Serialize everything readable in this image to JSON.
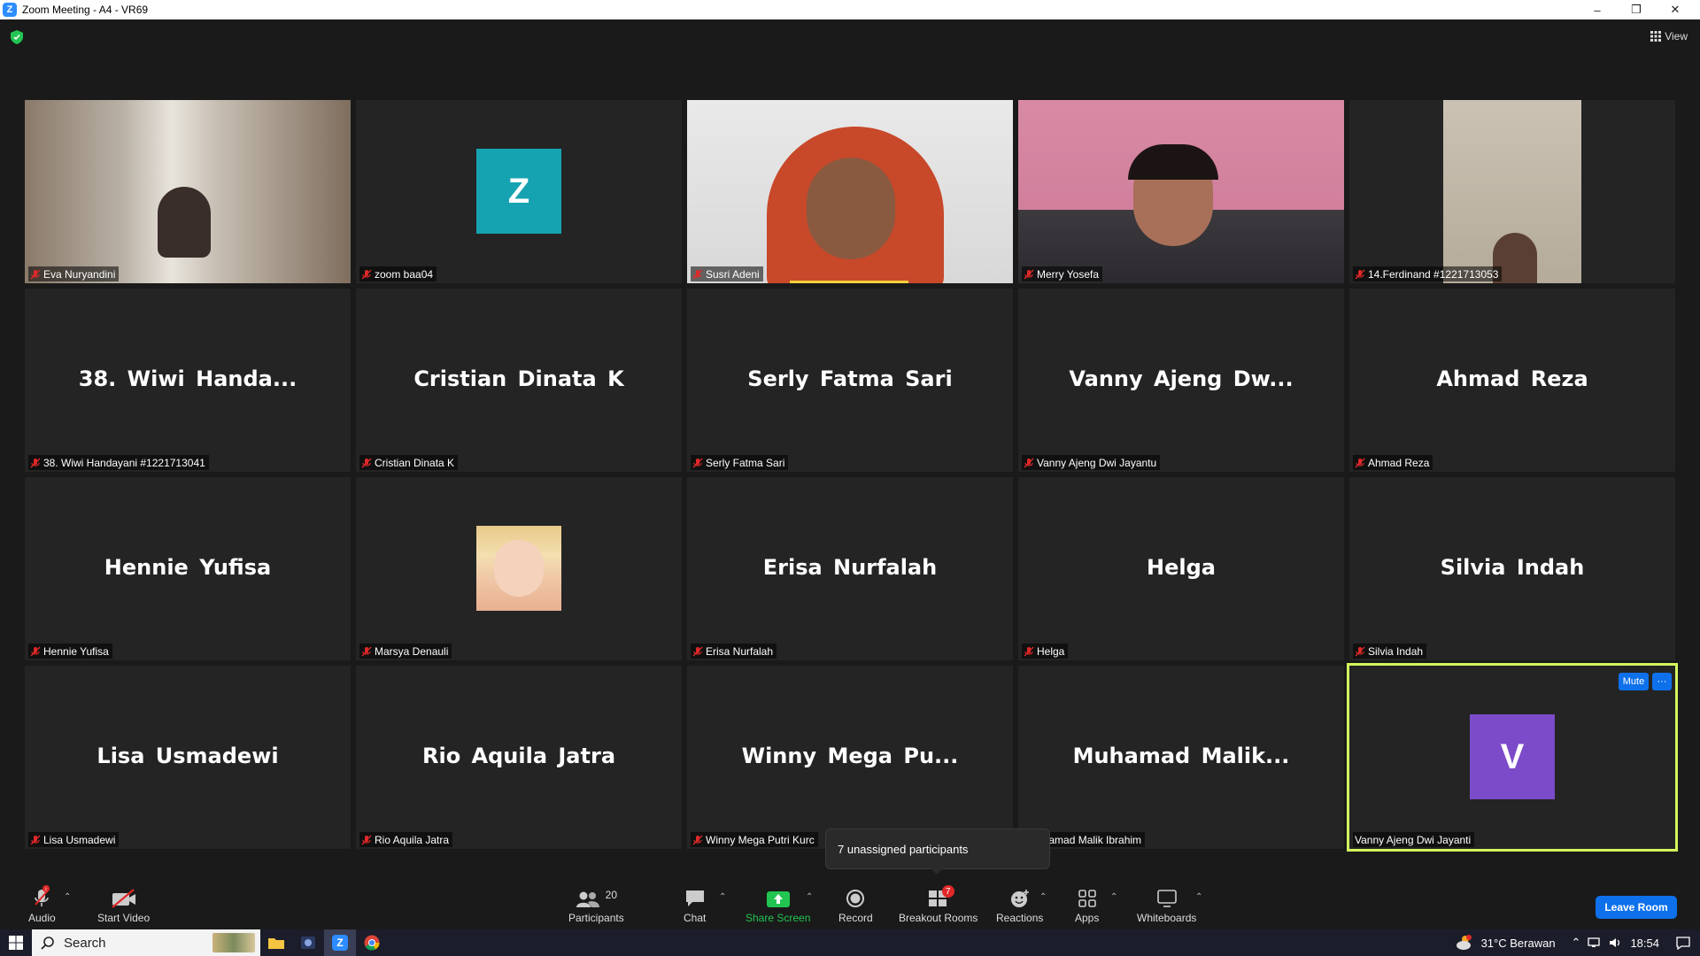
{
  "window": {
    "title": "Zoom Meeting - A4 - VR69"
  },
  "top": {
    "view_label": "View"
  },
  "tiles": [
    {
      "name": "Eva Nuryandini",
      "label": "Eva Nuryandini",
      "type": "video"
    },
    {
      "name": "zoom baa04",
      "label": "zoom baa04",
      "type": "avatar",
      "initial": "Z"
    },
    {
      "name": "Susri Adeni",
      "label": "Susri Adeni",
      "type": "video"
    },
    {
      "name": "Merry Yosefa",
      "label": "Merry Yosefa",
      "type": "video"
    },
    {
      "name": "14.Ferdinand",
      "label": "14.Ferdinand #1221713053",
      "type": "video"
    },
    {
      "name": "38. Wiwi Handa...",
      "label": "38. Wiwi Handayani #1221713041",
      "type": "name"
    },
    {
      "name": "Cristian Dinata K",
      "label": "Cristian Dinata K",
      "type": "name"
    },
    {
      "name": "Serly Fatma Sari",
      "label": "Serly Fatma Sari",
      "type": "name"
    },
    {
      "name": "Vanny Ajeng Dw...",
      "label": "Vanny Ajeng Dwi Jayantu",
      "type": "name"
    },
    {
      "name": "Ahmad Reza",
      "label": "Ahmad Reza",
      "type": "name"
    },
    {
      "name": "Hennie Yufisa",
      "label": "Hennie Yufisa",
      "type": "name"
    },
    {
      "name": "Marsya Denauli",
      "label": "Marsya Denauli",
      "type": "photo"
    },
    {
      "name": "Erisa Nurfalah",
      "label": "Erisa Nurfalah",
      "type": "name"
    },
    {
      "name": "Helga",
      "label": "Helga",
      "type": "name"
    },
    {
      "name": "Silvia Indah",
      "label": "Silvia Indah",
      "type": "name"
    },
    {
      "name": "Lisa Usmadewi",
      "label": "Lisa Usmadewi",
      "type": "name"
    },
    {
      "name": "Rio Aquila Jatra",
      "label": "Rio Aquila Jatra",
      "type": "name"
    },
    {
      "name": "Winny Mega Pu...",
      "label": "Winny Mega Putri Kurc",
      "type": "name"
    },
    {
      "name": "Muhamad Malik...",
      "label": "uhamad Malik Ibrahim",
      "type": "name"
    },
    {
      "name": "Vanny Ajeng Dwi Jayanti",
      "label": "Vanny Ajeng Dwi Jayanti",
      "type": "avatar",
      "initial": "V",
      "self": true
    }
  ],
  "self_tile": {
    "mute_label": "Mute",
    "more_label": "···"
  },
  "tooltip": "7 unassigned participants",
  "toolbar": {
    "audio": "Audio",
    "start_video": "Start Video",
    "participants": "Participants",
    "participants_count": "20",
    "chat": "Chat",
    "share_screen": "Share Screen",
    "record": "Record",
    "breakout_rooms": "Breakout Rooms",
    "breakout_badge": "7",
    "reactions": "Reactions",
    "apps": "Apps",
    "whiteboards": "Whiteboards",
    "leave": "Leave Room"
  },
  "taskbar": {
    "search": "Search",
    "weather": "31°C  Berawan",
    "time": "18:54"
  },
  "colors": {
    "accent": "#0e71eb",
    "active_speaker": "#d3f75e",
    "avatar_z": "#16a3b1",
    "avatar_v": "#7b4bc9",
    "share_green": "#23c552",
    "badge_red": "#e02828"
  }
}
